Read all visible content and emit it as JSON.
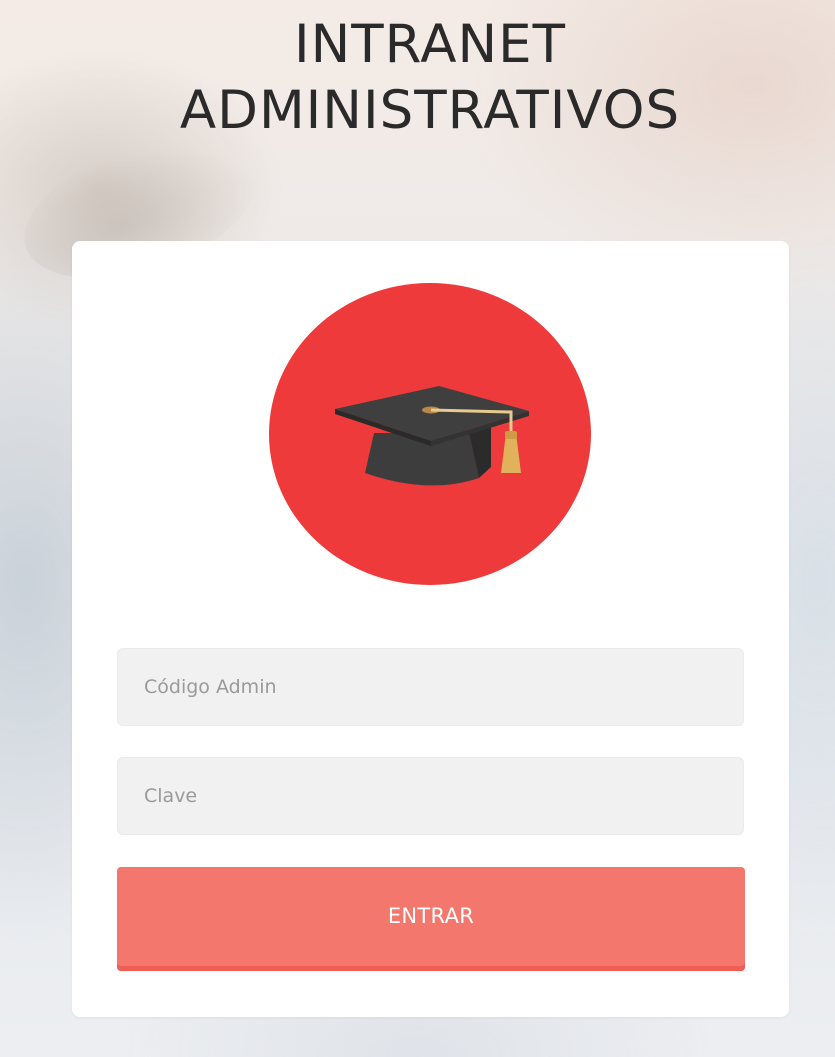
{
  "header": {
    "title_line1": "INTRANET",
    "title_line2": "ADMINISTRATIVOS"
  },
  "login": {
    "logo_icon": "graduation-cap-icon",
    "code_placeholder": "Código Admin",
    "code_value": "",
    "password_placeholder": "Clave",
    "password_value": "",
    "submit_label": "ENTRAR"
  },
  "colors": {
    "logo_circle": "#ee3a3a",
    "button": "#f4776d",
    "card": "#ffffff",
    "input_bg": "#f1f1f1",
    "title_text": "#2a2a2a"
  }
}
